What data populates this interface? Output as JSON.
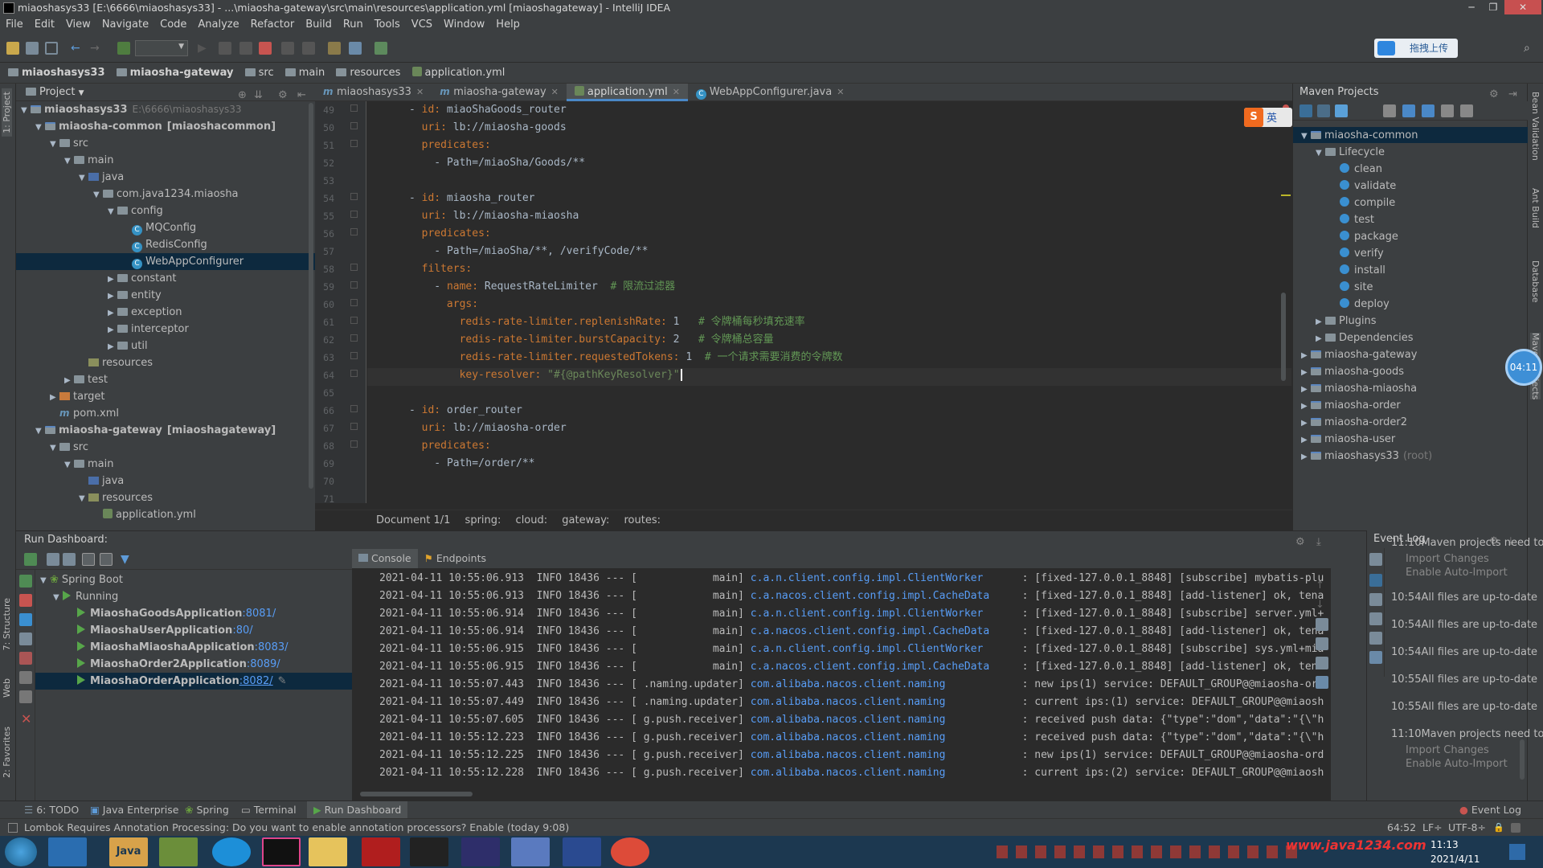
{
  "window": {
    "title": "miaoshasys33 [E:\\6666\\miaoshasys33] - ...\\miaosha-gateway\\src\\main\\resources\\application.yml [miaoshagateway] - IntelliJ IDEA"
  },
  "menu": [
    "File",
    "Edit",
    "View",
    "Navigate",
    "Code",
    "Analyze",
    "Refactor",
    "Build",
    "Run",
    "Tools",
    "VCS",
    "Window",
    "Help"
  ],
  "upload_button": "拖拽上传",
  "breadcrumb": [
    "miaoshasys33",
    "miaosha-gateway",
    "src",
    "main",
    "resources",
    "application.yml"
  ],
  "project_panel": {
    "title": "Project",
    "tree": [
      {
        "label": "miaoshasys33",
        "extra": "E:\\6666\\miaoshasys33",
        "level": 0,
        "expanded": true,
        "icon": "module"
      },
      {
        "label": "miaosha-common",
        "extra": "[miaoshacommon]",
        "level": 1,
        "expanded": true,
        "icon": "module"
      },
      {
        "label": "src",
        "level": 2,
        "expanded": true,
        "icon": "folder"
      },
      {
        "label": "main",
        "level": 3,
        "expanded": true,
        "icon": "folder"
      },
      {
        "label": "java",
        "level": 4,
        "expanded": true,
        "icon": "src"
      },
      {
        "label": "com.java1234.miaosha",
        "level": 5,
        "expanded": true,
        "icon": "folder"
      },
      {
        "label": "config",
        "level": 6,
        "expanded": true,
        "icon": "folder"
      },
      {
        "label": "MQConfig",
        "level": 7,
        "icon": "class"
      },
      {
        "label": "RedisConfig",
        "level": 7,
        "icon": "class"
      },
      {
        "label": "WebAppConfigurer",
        "level": 7,
        "icon": "class",
        "selected": true
      },
      {
        "label": "constant",
        "level": 6,
        "expanded": false,
        "icon": "folder"
      },
      {
        "label": "entity",
        "level": 6,
        "expanded": false,
        "icon": "folder"
      },
      {
        "label": "exception",
        "level": 6,
        "expanded": false,
        "icon": "folder"
      },
      {
        "label": "interceptor",
        "level": 6,
        "expanded": false,
        "icon": "folder"
      },
      {
        "label": "util",
        "level": 6,
        "expanded": false,
        "icon": "folder"
      },
      {
        "label": "resources",
        "level": 4,
        "icon": "res"
      },
      {
        "label": "test",
        "level": 3,
        "expanded": false,
        "icon": "folder"
      },
      {
        "label": "target",
        "level": 2,
        "expanded": false,
        "icon": "target"
      },
      {
        "label": "pom.xml",
        "level": 2,
        "icon": "maven"
      },
      {
        "label": "miaosha-gateway",
        "extra": "[miaoshagateway]",
        "level": 1,
        "expanded": true,
        "icon": "module"
      },
      {
        "label": "src",
        "level": 2,
        "expanded": true,
        "icon": "folder"
      },
      {
        "label": "main",
        "level": 3,
        "expanded": true,
        "icon": "folder"
      },
      {
        "label": "java",
        "level": 4,
        "icon": "src"
      },
      {
        "label": "resources",
        "level": 4,
        "expanded": true,
        "icon": "res"
      },
      {
        "label": "application.yml",
        "level": 5,
        "icon": "yml"
      }
    ]
  },
  "editor": {
    "tabs": [
      {
        "label": "miaoshasys33",
        "active": false
      },
      {
        "label": "miaosha-gateway",
        "active": false
      },
      {
        "label": "application.yml",
        "active": true
      },
      {
        "label": "WebAppConfigurer.java",
        "active": false
      }
    ],
    "lines": [
      {
        "n": "49",
        "indent": "      ",
        "dash": "- ",
        "key": "id:",
        "val": " miaoShaGoods_router",
        "comment": ""
      },
      {
        "n": "50",
        "indent": "        ",
        "dash": "",
        "key": "uri:",
        "val": " lb://miaosha-goods",
        "comment": ""
      },
      {
        "n": "51",
        "indent": "        ",
        "dash": "",
        "key": "predicates:",
        "val": "",
        "comment": ""
      },
      {
        "n": "52",
        "indent": "          ",
        "dash": "- ",
        "key": "",
        "val": "Path=/miaoSha/Goods/**",
        "comment": ""
      },
      {
        "n": "53",
        "indent": "",
        "dash": "",
        "key": "",
        "val": "",
        "comment": ""
      },
      {
        "n": "54",
        "indent": "      ",
        "dash": "- ",
        "key": "id:",
        "val": " miaosha_router",
        "comment": ""
      },
      {
        "n": "55",
        "indent": "        ",
        "dash": "",
        "key": "uri:",
        "val": " lb://miaosha-miaosha",
        "comment": ""
      },
      {
        "n": "56",
        "indent": "        ",
        "dash": "",
        "key": "predicates:",
        "val": "",
        "comment": ""
      },
      {
        "n": "57",
        "indent": "          ",
        "dash": "- ",
        "key": "",
        "val": "Path=/miaoSha/**, /verifyCode/**",
        "comment": ""
      },
      {
        "n": "58",
        "indent": "        ",
        "dash": "",
        "key": "filters:",
        "val": "",
        "comment": ""
      },
      {
        "n": "59",
        "indent": "          ",
        "dash": "- ",
        "key": "name:",
        "val": " RequestRateLimiter  ",
        "comment": "# 限流过滤器"
      },
      {
        "n": "60",
        "indent": "            ",
        "dash": "",
        "key": "args:",
        "val": "",
        "comment": ""
      },
      {
        "n": "61",
        "indent": "              ",
        "dash": "",
        "key": "redis-rate-limiter.replenishRate:",
        "val": " 1   ",
        "comment": "# 令牌桶每秒填充速率"
      },
      {
        "n": "62",
        "indent": "              ",
        "dash": "",
        "key": "redis-rate-limiter.burstCapacity:",
        "val": " 2   ",
        "comment": "# 令牌桶总容量"
      },
      {
        "n": "63",
        "indent": "              ",
        "dash": "",
        "key": "redis-rate-limiter.requestedTokens:",
        "val": " 1  ",
        "comment": "# 一个请求需要消费的令牌数"
      },
      {
        "n": "64",
        "indent": "              ",
        "dash": "",
        "key": "key-resolver:",
        "val": " ",
        "str": "\"#{@pathKeyResolver}\"",
        "comment": ""
      },
      {
        "n": "65",
        "indent": "",
        "dash": "",
        "key": "",
        "val": "",
        "comment": ""
      },
      {
        "n": "66",
        "indent": "      ",
        "dash": "- ",
        "key": "id:",
        "val": " order_router",
        "comment": ""
      },
      {
        "n": "67",
        "indent": "        ",
        "dash": "",
        "key": "uri:",
        "val": " lb://miaosha-order",
        "comment": ""
      },
      {
        "n": "68",
        "indent": "        ",
        "dash": "",
        "key": "predicates:",
        "val": "",
        "comment": ""
      },
      {
        "n": "69",
        "indent": "          ",
        "dash": "- ",
        "key": "",
        "val": "Path=/order/**",
        "comment": ""
      },
      {
        "n": "70",
        "indent": "",
        "dash": "",
        "key": "",
        "val": "",
        "comment": ""
      },
      {
        "n": "71",
        "indent": "",
        "dash": "",
        "key": "",
        "val": "",
        "comment": ""
      }
    ],
    "path_crumbs": [
      "Document 1/1",
      "spring:",
      "cloud:",
      "gateway:",
      "routes:"
    ]
  },
  "maven": {
    "title": "Maven Projects",
    "items": [
      {
        "label": "miaosha-common",
        "level": 0,
        "kind": "module",
        "expanded": true
      },
      {
        "label": "Lifecycle",
        "level": 1,
        "kind": "folder",
        "expanded": true
      },
      {
        "label": "clean",
        "level": 2,
        "kind": "goal"
      },
      {
        "label": "validate",
        "level": 2,
        "kind": "goal"
      },
      {
        "label": "compile",
        "level": 2,
        "kind": "goal"
      },
      {
        "label": "test",
        "level": 2,
        "kind": "goal"
      },
      {
        "label": "package",
        "level": 2,
        "kind": "goal"
      },
      {
        "label": "verify",
        "level": 2,
        "kind": "goal"
      },
      {
        "label": "install",
        "level": 2,
        "kind": "goal"
      },
      {
        "label": "site",
        "level": 2,
        "kind": "goal"
      },
      {
        "label": "deploy",
        "level": 2,
        "kind": "goal"
      },
      {
        "label": "Plugins",
        "level": 1,
        "kind": "folder",
        "expanded": false
      },
      {
        "label": "Dependencies",
        "level": 1,
        "kind": "folder",
        "expanded": false
      },
      {
        "label": "miaosha-gateway",
        "level": 0,
        "kind": "module",
        "expanded": false
      },
      {
        "label": "miaosha-goods",
        "level": 0,
        "kind": "module",
        "expanded": false
      },
      {
        "label": "miaosha-miaosha",
        "level": 0,
        "kind": "module",
        "expanded": false
      },
      {
        "label": "miaosha-order",
        "level": 0,
        "kind": "module",
        "expanded": false
      },
      {
        "label": "miaosha-order2",
        "level": 0,
        "kind": "module",
        "expanded": false
      },
      {
        "label": "miaosha-user",
        "level": 0,
        "kind": "module",
        "expanded": false
      },
      {
        "label": "miaoshasys33",
        "extra": "(root)",
        "level": 0,
        "kind": "module",
        "expanded": false
      }
    ],
    "timer_badge": "04:11"
  },
  "run_dashboard": {
    "title": "Run Dashboard:",
    "root": "Spring Boot",
    "group": "Running",
    "apps": [
      {
        "name": "MiaoshaGoodsApplication",
        "port": ":8081/",
        "selected": false
      },
      {
        "name": "MiaoshaUserApplication",
        "port": ":80/",
        "selected": false
      },
      {
        "name": "MiaoshaMiaoshaApplication",
        "port": ":8083/",
        "selected": false
      },
      {
        "name": "MiaoshaOrder2Application",
        "port": ":8089/",
        "selected": false
      },
      {
        "name": "MiaoshaOrderApplication",
        "port": ":8082/",
        "selected": true
      }
    ],
    "console_tabs": [
      "Console",
      "Endpoints"
    ],
    "log": [
      {
        "ts": "2021-04-11 10:55:06.913",
        "lvl": "INFO 18436 --- [",
        "thread": "           main]",
        "logger": "c.a.n.client.config.impl.ClientWorker",
        "msg": ": [fixed-127.0.0.1_8848] [subscribe] mybatis-plu"
      },
      {
        "ts": "2021-04-11 10:55:06.913",
        "lvl": "INFO 18436 --- [",
        "thread": "           main]",
        "logger": "c.a.nacos.client.config.impl.CacheData",
        "msg": ": [fixed-127.0.0.1_8848] [add-listener] ok, tena"
      },
      {
        "ts": "2021-04-11 10:55:06.914",
        "lvl": "INFO 18436 --- [",
        "thread": "           main]",
        "logger": "c.a.n.client.config.impl.ClientWorker",
        "msg": ": [fixed-127.0.0.1_8848] [subscribe] server.yml+"
      },
      {
        "ts": "2021-04-11 10:55:06.914",
        "lvl": "INFO 18436 --- [",
        "thread": "           main]",
        "logger": "c.a.nacos.client.config.impl.CacheData",
        "msg": ": [fixed-127.0.0.1_8848] [add-listener] ok, tena"
      },
      {
        "ts": "2021-04-11 10:55:06.915",
        "lvl": "INFO 18436 --- [",
        "thread": "           main]",
        "logger": "c.a.n.client.config.impl.ClientWorker",
        "msg": ": [fixed-127.0.0.1_8848] [subscribe] sys.yml+mia"
      },
      {
        "ts": "2021-04-11 10:55:06.915",
        "lvl": "INFO 18436 --- [",
        "thread": "           main]",
        "logger": "c.a.nacos.client.config.impl.CacheData",
        "msg": ": [fixed-127.0.0.1_8848] [add-listener] ok, tena"
      },
      {
        "ts": "2021-04-11 10:55:07.443",
        "lvl": "INFO 18436 --- [",
        "thread": ".naming.updater]",
        "logger": "com.alibaba.nacos.client.naming",
        "msg": ": new ips(1) service: DEFAULT_GROUP@@miaosha-ord"
      },
      {
        "ts": "2021-04-11 10:55:07.449",
        "lvl": "INFO 18436 --- [",
        "thread": ".naming.updater]",
        "logger": "com.alibaba.nacos.client.naming",
        "msg": ": current ips:(1) service: DEFAULT_GROUP@@miaosh"
      },
      {
        "ts": "2021-04-11 10:55:07.605",
        "lvl": "INFO 18436 --- [",
        "thread": "g.push.receiver]",
        "logger": "com.alibaba.nacos.client.naming",
        "msg": ": received push data: {\"type\":\"dom\",\"data\":\"{\\\"h"
      },
      {
        "ts": "2021-04-11 10:55:12.223",
        "lvl": "INFO 18436 --- [",
        "thread": "g.push.receiver]",
        "logger": "com.alibaba.nacos.client.naming",
        "msg": ": received push data: {\"type\":\"dom\",\"data\":\"{\\\"h"
      },
      {
        "ts": "2021-04-11 10:55:12.225",
        "lvl": "INFO 18436 --- [",
        "thread": "g.push.receiver]",
        "logger": "com.alibaba.nacos.client.naming",
        "msg": ": new ips(1) service: DEFAULT_GROUP@@miaosha-ord"
      },
      {
        "ts": "2021-04-11 10:55:12.228",
        "lvl": "INFO 18436 --- [",
        "thread": "g.push.receiver]",
        "logger": "com.alibaba.nacos.client.naming",
        "msg": ": current ips:(2) service: DEFAULT_GROUP@@miaosh"
      }
    ]
  },
  "event_log": {
    "title": "Event Log",
    "entries": [
      {
        "time": "11:10",
        "text": "Maven projects need to be i",
        "links": [
          "Import Changes",
          "Enable Auto-Import"
        ]
      },
      {
        "time": "10:54",
        "text": "All files are up-to-date",
        "links": []
      },
      {
        "time": "10:54",
        "text": "All files are up-to-date",
        "links": []
      },
      {
        "time": "10:54",
        "text": "All files are up-to-date",
        "links": []
      },
      {
        "time": "10:55",
        "text": "All files are up-to-date",
        "links": []
      },
      {
        "time": "10:55",
        "text": "All files are up-to-date",
        "links": []
      },
      {
        "time": "11:10",
        "text": "Maven projects need to be i",
        "links": [
          "Import Changes",
          "Enable Auto-Import"
        ]
      }
    ]
  },
  "tool_tabs": [
    "6: TODO",
    "Java Enterprise",
    "Spring",
    "Terminal",
    "Run Dashboard"
  ],
  "event_log_tab": "Event Log",
  "left_tool_tabs": [
    "1: Project",
    "7: Structure",
    "Web",
    "2: Favorites"
  ],
  "right_tool_tabs": [
    "Bean Validation",
    "Ant Build",
    "Database",
    "Maven Projects"
  ],
  "status": {
    "message": "Lombok Requires Annotation Processing: Do you want to enable annotation processors? Enable (today 9:08)",
    "position": "64:52",
    "line_sep": "LF÷",
    "encoding": "UTF-8÷"
  },
  "taskbar": {
    "clock_time": "11:13",
    "clock_date": "2021/4/11",
    "java_label": "Java",
    "watermark": "www.java1234.com"
  }
}
